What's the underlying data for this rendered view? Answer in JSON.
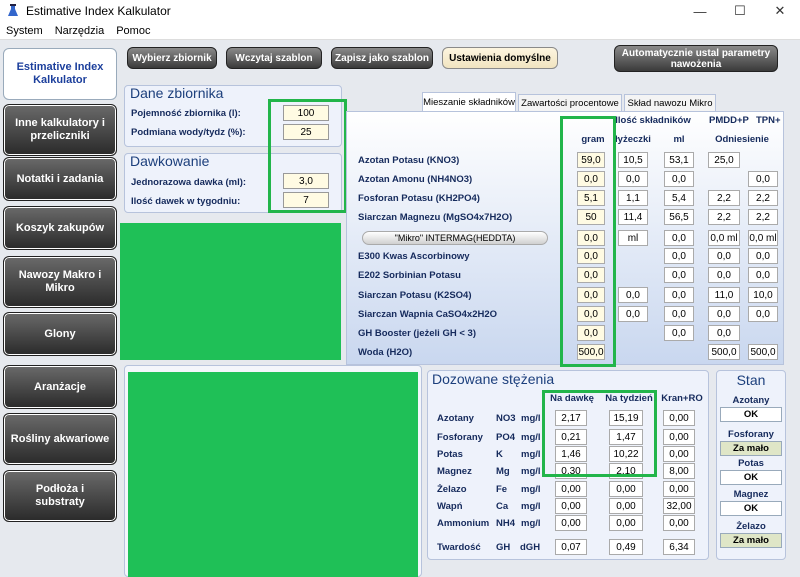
{
  "window": {
    "title": "Estimative Index Kalkulator",
    "minimize": "—",
    "maximize": "☐",
    "close": "✕"
  },
  "menu": [
    "System",
    "Narzędzia",
    "Pomoc"
  ],
  "sidebar": [
    "Estimative Index Kalkulator",
    "Inne kalkulatory i przeliczniki",
    "Notatki i zadania",
    "Koszyk zakupów",
    "Nawozy Makro i Mikro",
    "Glony",
    "Aranżacje",
    "Rośliny akwariowe",
    "Podłoża i substraty"
  ],
  "toolbar": {
    "select": "Wybierz zbiornik",
    "load": "Wczytaj szablon",
    "save": "Zapisz jako szablon",
    "defaults": "Ustawienia domyślne",
    "auto": "Automatycznie ustal parametry nawożenia"
  },
  "tank": {
    "title": "Dane zbiornika",
    "volume_label": "Pojemność zbiornika (l):",
    "volume": "100",
    "change_label": "Podmiana wody/tydz (%):",
    "change": "25"
  },
  "dosing": {
    "title": "Dawkowanie",
    "dose_label": "Jednorazowa dawka (ml):",
    "dose": "3,0",
    "count_label": "Ilość dawek w tygodniu:",
    "count": "7"
  },
  "tabs": [
    "Mieszanie składników",
    "Zawartości procentowe",
    "Skład nawozu Mikro"
  ],
  "mix": {
    "header_amount": "Ilość składników",
    "header_pmdd": "PMDD+P",
    "header_tpn": "TPN+",
    "col_g": "gram",
    "col_spoon": "łyżeczki",
    "col_ml": "ml",
    "col_ref": "Odniesienie",
    "mikro_button": "\"Mikro\" INTERMAG(HEDDTA)",
    "rows": [
      {
        "name": "Azotan Potasu (KNO3)",
        "g": "59,0",
        "spoon": "10,5",
        "ml": "53,1",
        "pmdd": "25,0",
        "tpn": ""
      },
      {
        "name": "Azotan Amonu (NH4NO3)",
        "g": "0,0",
        "spoon": "0,0",
        "ml": "0,0",
        "pmdd": "",
        "tpn": "0,0"
      },
      {
        "name": "Fosforan Potasu (KH2PO4)",
        "g": "5,1",
        "spoon": "1,1",
        "ml": "5,4",
        "pmdd": "2,2",
        "tpn": "2,2"
      },
      {
        "name": "Siarczan Magnezu (MgSO4x7H2O)",
        "g": "50",
        "spoon": "11,4",
        "ml": "56,5",
        "pmdd": "2,2",
        "tpn": "2,2"
      },
      {
        "name": "",
        "g": "0,0",
        "spoon": "ml",
        "ml": "0,0",
        "pmdd": "0,0 ml",
        "tpn": "0,0 ml"
      },
      {
        "name": "E300 Kwas Ascorbinowy",
        "g": "0,0",
        "spoon": "",
        "ml": "0,0",
        "pmdd": "0,0",
        "tpn": "0,0"
      },
      {
        "name": "E202 Sorbinian Potasu",
        "g": "0,0",
        "spoon": "",
        "ml": "0,0",
        "pmdd": "0,0",
        "tpn": "0,0"
      },
      {
        "name": "Siarczan Potasu (K2SO4)",
        "g": "0,0",
        "spoon": "0,0",
        "ml": "0,0",
        "pmdd": "11,0",
        "tpn": "10,0"
      },
      {
        "name": "Siarczan Wapnia CaSO4x2H2O",
        "g": "0,0",
        "spoon": "0,0",
        "ml": "0,0",
        "pmdd": "0,0",
        "tpn": "0,0"
      },
      {
        "name": "GH Booster (jeżeli GH < 3)",
        "g": "0,0",
        "spoon": "",
        "ml": "0,0",
        "pmdd": "0,0",
        "tpn": ""
      },
      {
        "name": "Woda (H2O)",
        "g": "500,0",
        "spoon": "",
        "ml": "",
        "pmdd": "500,0",
        "tpn": "500,0"
      }
    ]
  },
  "conc": {
    "title": "Dozowane stężenia",
    "col_dose": "Na dawkę",
    "col_week": "Na tydzień",
    "col_tap": "Kran+RO",
    "rows": [
      {
        "name": "Azotany",
        "sym": "NO3",
        "unit": "mg/l",
        "dose": "2,17",
        "week": "15,19",
        "tap": "0,00"
      },
      {
        "name": "Fosforany",
        "sym": "PO4",
        "unit": "mg/l",
        "dose": "0,21",
        "week": "1,47",
        "tap": "0,00"
      },
      {
        "name": "Potas",
        "sym": "K",
        "unit": "mg/l",
        "dose": "1,46",
        "week": "10,22",
        "tap": "0,00"
      },
      {
        "name": "Magnez",
        "sym": "Mg",
        "unit": "mg/l",
        "dose": "0,30",
        "week": "2,10",
        "tap": "8,00"
      },
      {
        "name": "Żelazo",
        "sym": "Fe",
        "unit": "mg/l",
        "dose": "0,00",
        "week": "0,00",
        "tap": "0,00"
      },
      {
        "name": "Wapń",
        "sym": "Ca",
        "unit": "mg/l",
        "dose": "0,00",
        "week": "0,00",
        "tap": "32,00"
      },
      {
        "name": "Ammonium",
        "sym": "NH4",
        "unit": "mg/l",
        "dose": "0,00",
        "week": "0,00",
        "tap": "0,00"
      }
    ],
    "hard_name": "Twardość",
    "hard_sym": "GH",
    "hard_unit": "dGH",
    "hard_dose": "0,07",
    "hard_week": "0,49",
    "hard_tap": "6,34"
  },
  "stan": {
    "title": "Stan",
    "items": [
      {
        "label": "Azotany",
        "value": "OK"
      },
      {
        "label": "Fosforany",
        "value": "Za mało"
      },
      {
        "label": "Potas",
        "value": "OK"
      },
      {
        "label": "Magnez",
        "value": "OK"
      },
      {
        "label": "Żelazo",
        "value": "Za mało"
      }
    ]
  },
  "colors": {
    "highlight": "#22b54a",
    "redact": "#1fc057",
    "label": "#152a5c"
  }
}
